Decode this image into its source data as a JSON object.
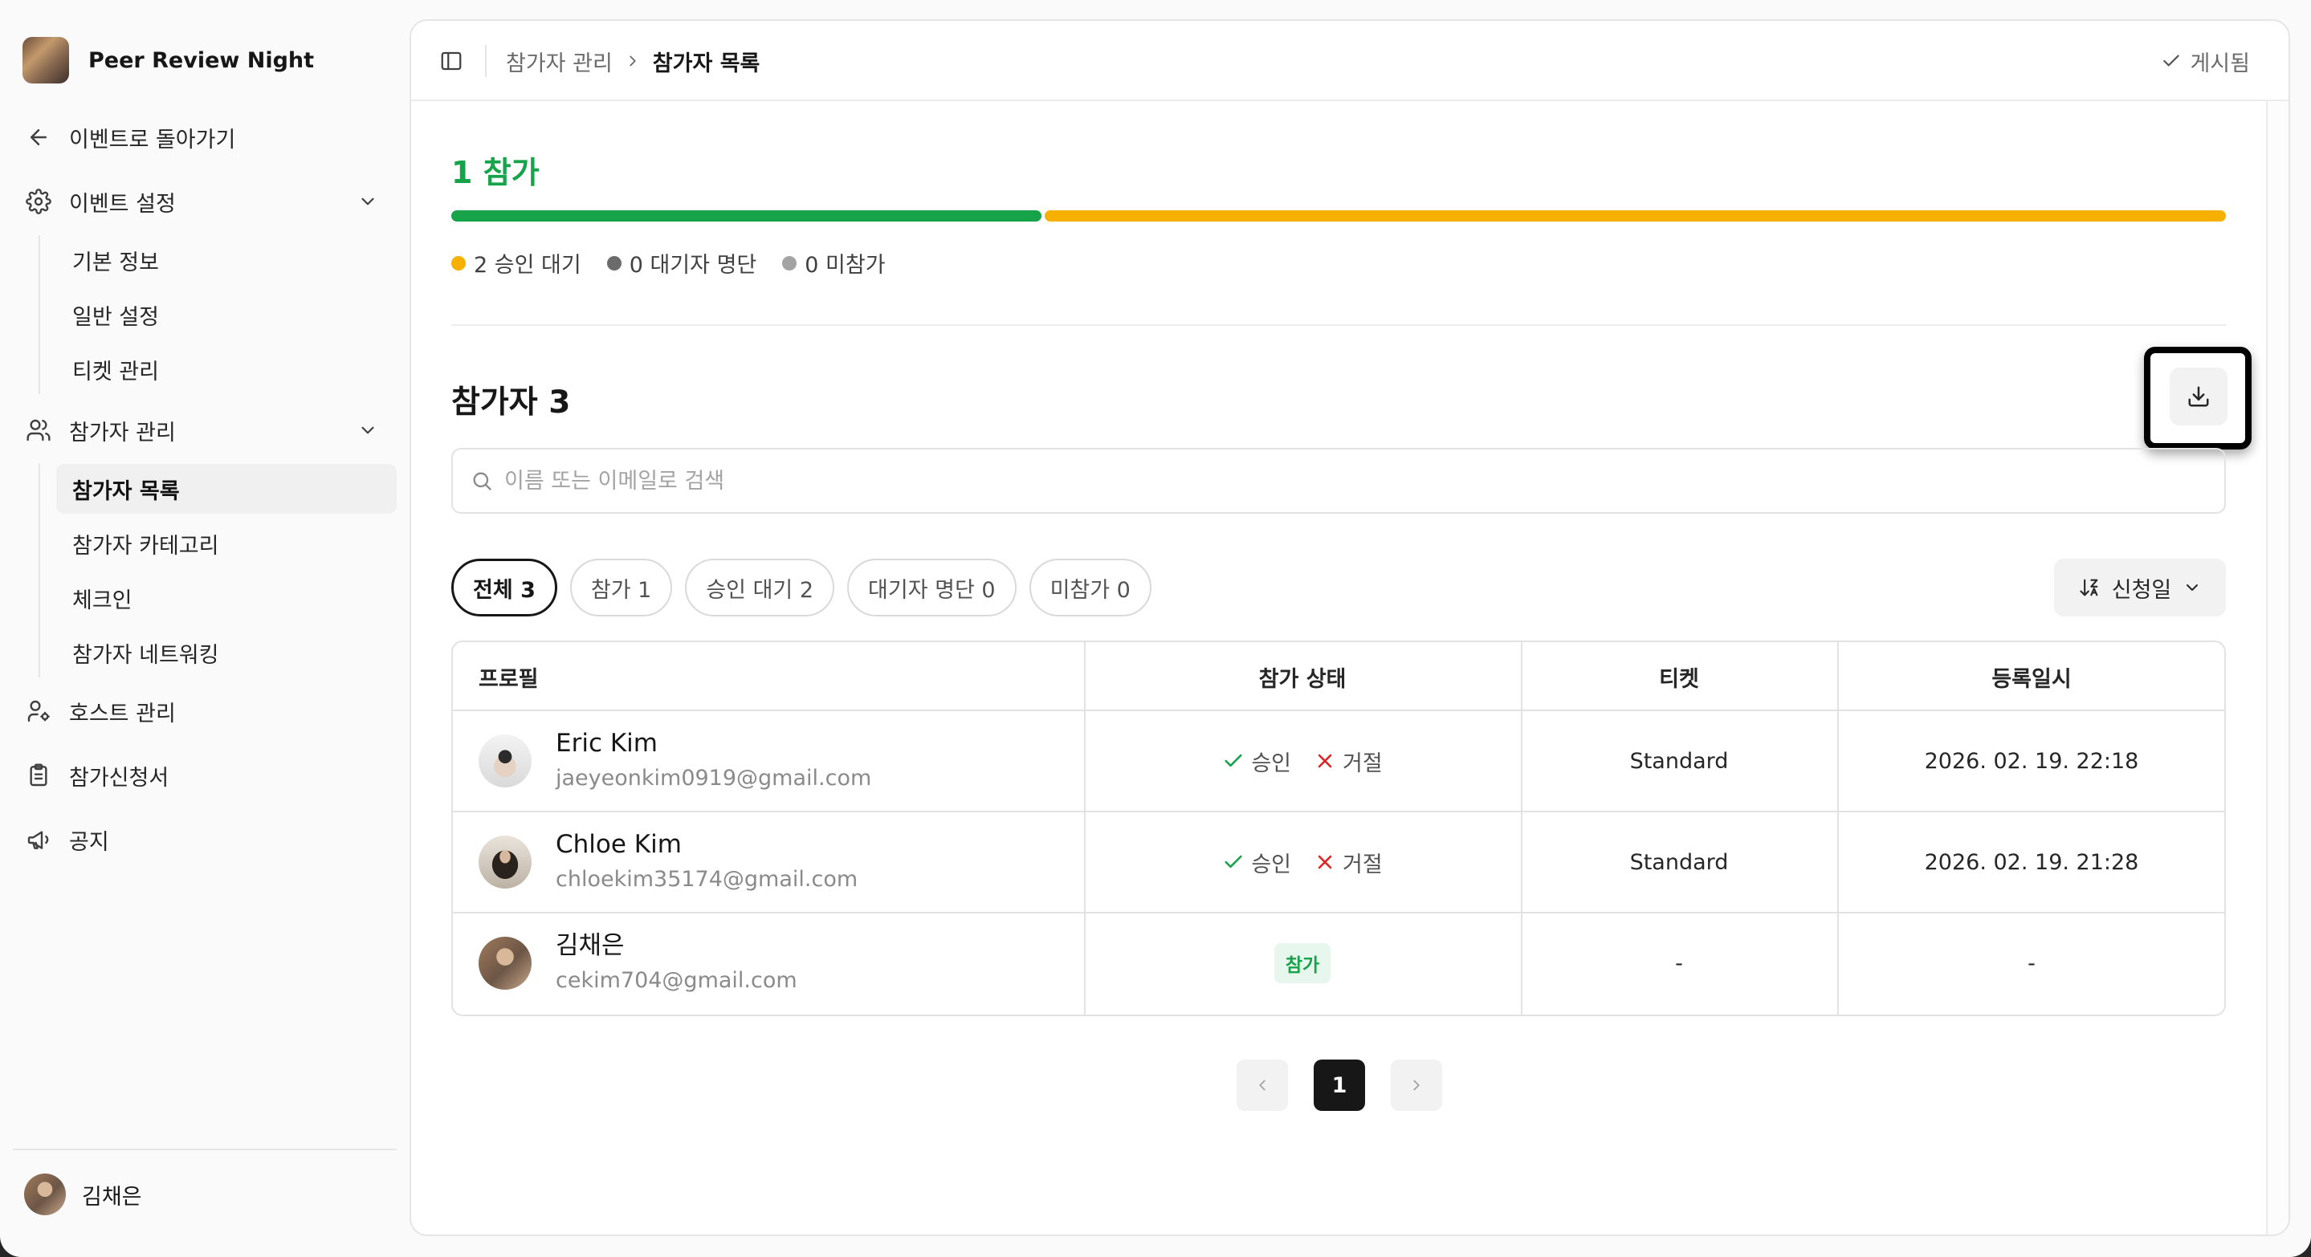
{
  "sidebar": {
    "event_name": "Peer Review Night",
    "back": "이벤트로 돌아가기",
    "event_settings": {
      "label": "이벤트 설정",
      "items": [
        "기본 정보",
        "일반 설정",
        "티켓 관리"
      ]
    },
    "participant_mgmt": {
      "label": "참가자 관리",
      "items": [
        "참가자 목록",
        "참가자 카테고리",
        "체크인",
        "참가자 네트워킹"
      ],
      "active_index": 0
    },
    "host_mgmt": "호스트 관리",
    "application_form": "참가신청서",
    "announcement": "공지",
    "user_name": "김채은"
  },
  "header": {
    "breadcrumb_parent": "참가자 관리",
    "breadcrumb_current": "참가자 목록",
    "status": "게시됨"
  },
  "summary": {
    "title": "1 참가",
    "progress": {
      "attending": 1,
      "pending": 2,
      "waitlist": 0,
      "not_attending": 0
    },
    "legend": [
      "2 승인 대기",
      "0 대기자 명단",
      "0 미참가"
    ],
    "colors": {
      "attending": "#16a34a",
      "pending": "#f5b000",
      "waitlist": "#6b6b6b",
      "not_attending": "#a3a3a3"
    }
  },
  "list": {
    "title": "참가자 3",
    "search_placeholder": "이름 또는 이메일로 검색",
    "filters": [
      "전체 3",
      "참가 1",
      "승인 대기 2",
      "대기자 명단 0",
      "미참가 0"
    ],
    "active_filter": 0,
    "sort_label": "신청일",
    "columns": [
      "프로필",
      "참가 상태",
      "티켓",
      "등록일시"
    ],
    "approve_label": "승인",
    "reject_label": "거절",
    "rows": [
      {
        "name": "Eric Kim",
        "email": "jaeyeonkim0919@gmail.com",
        "status": "pending",
        "ticket": "Standard",
        "registered": "2026. 02. 19. 22:18"
      },
      {
        "name": "Chloe Kim",
        "email": "chloekim35174@gmail.com",
        "status": "pending",
        "ticket": "Standard",
        "registered": "2026. 02. 19. 21:28"
      },
      {
        "name": "김채은",
        "email": "cekim704@gmail.com",
        "status": "참가",
        "ticket": "-",
        "registered": "-"
      }
    ]
  },
  "pagination": {
    "current": "1"
  }
}
